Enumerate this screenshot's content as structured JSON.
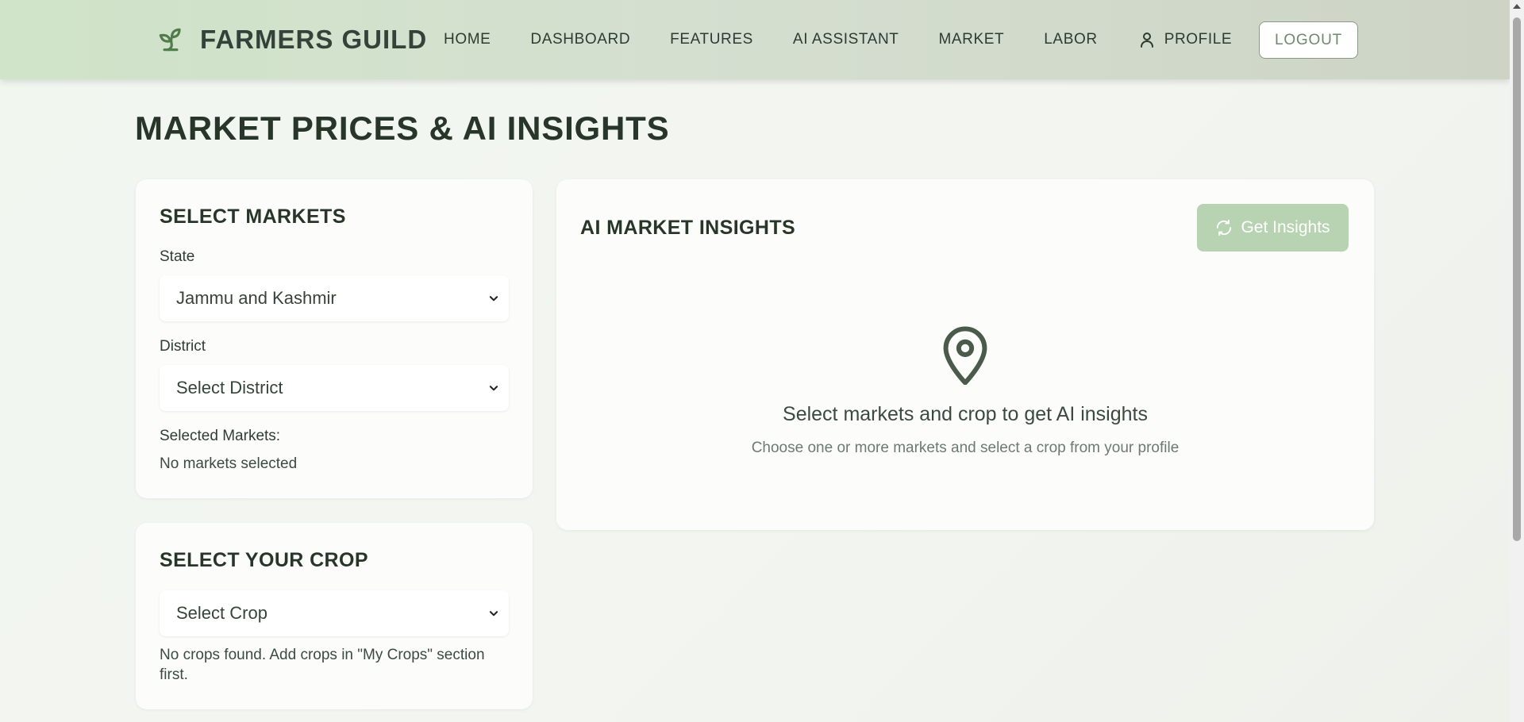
{
  "brand": {
    "name": "FARMERS GUILD",
    "icon": "sprout-icon"
  },
  "nav": {
    "items": [
      {
        "label": "HOME"
      },
      {
        "label": "DASHBOARD"
      },
      {
        "label": "FEATURES"
      },
      {
        "label": "AI ASSISTANT"
      },
      {
        "label": "MARKET"
      },
      {
        "label": "LABOR"
      },
      {
        "label": "PROFILE",
        "icon": "user-icon"
      }
    ],
    "logout_label": "LOGOUT"
  },
  "page": {
    "title": "MARKET PRICES & AI INSIGHTS"
  },
  "markets_card": {
    "title": "SELECT MARKETS",
    "state_label": "State",
    "state_value": "Jammu and Kashmir",
    "district_label": "District",
    "district_value": "Select District",
    "selected_label": "Selected Markets:",
    "selected_value": "No markets selected"
  },
  "crop_card": {
    "title": "SELECT YOUR CROP",
    "crop_value": "Select Crop",
    "message": "No crops found. Add crops in \"My Crops\" section first."
  },
  "insights_card": {
    "title": "AI MARKET INSIGHTS",
    "button_label": "Get Insights",
    "button_icon": "refresh-icon",
    "empty_icon": "map-pin-icon",
    "empty_title": "Select markets and crop to get AI insights",
    "empty_subtitle": "Choose one or more markets and select a crop from your profile"
  },
  "colors": {
    "nav_bg": "#d5dfd0",
    "accent_green": "#b8d3b2",
    "text_dark": "#28362a"
  }
}
